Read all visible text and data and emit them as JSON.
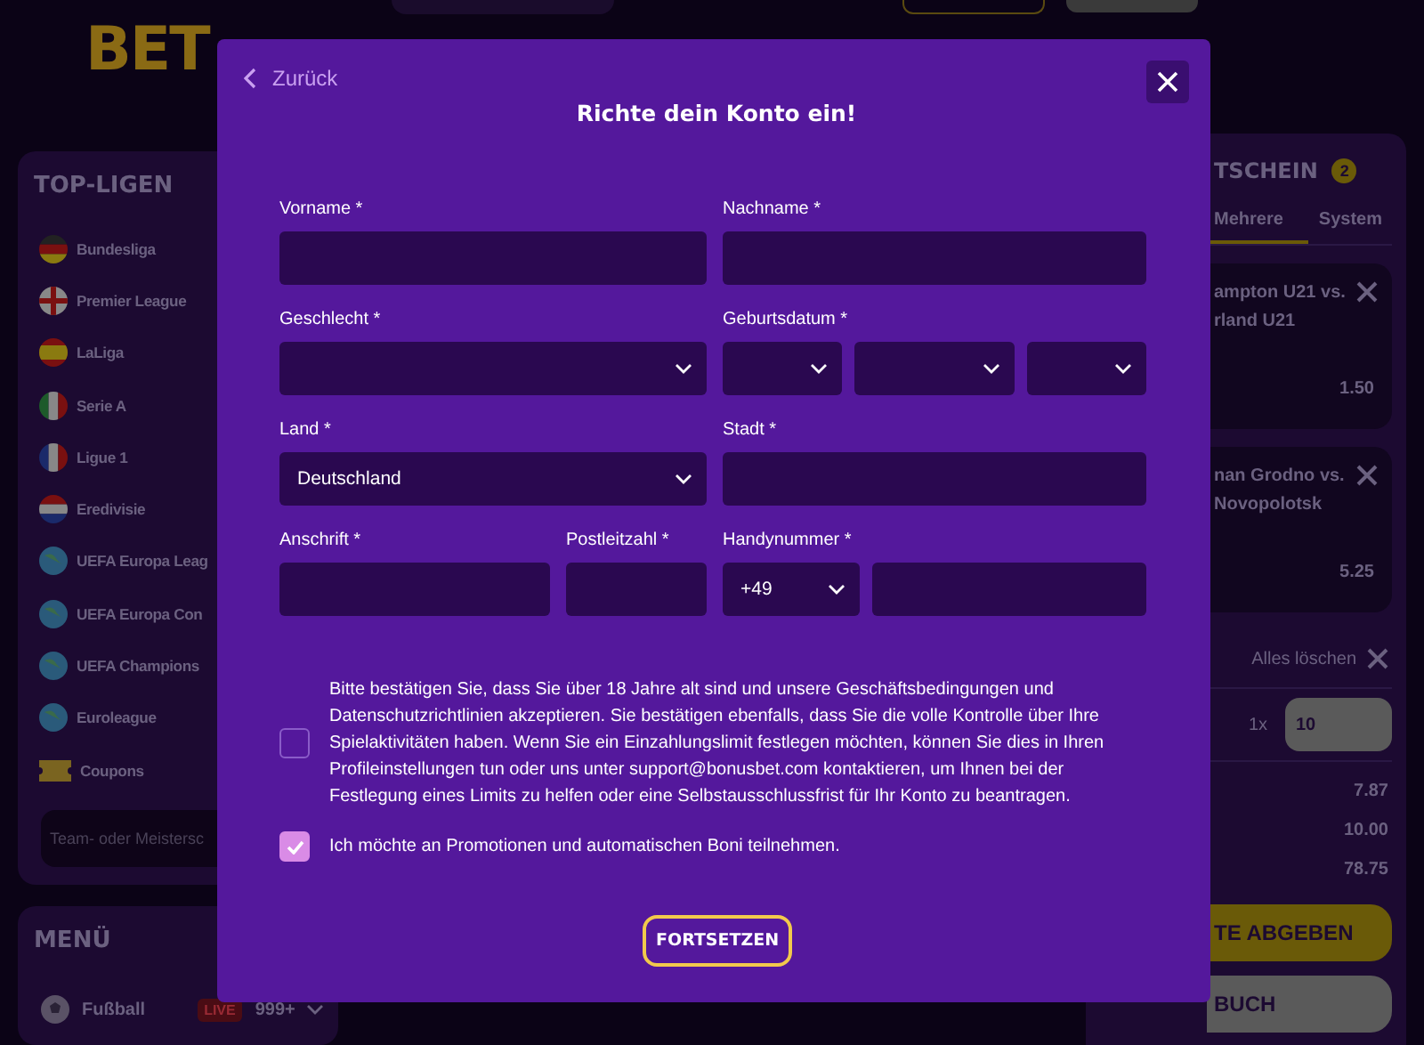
{
  "header": {
    "logo_text": "BET"
  },
  "sidebar": {
    "title": "TOP-LIGEN",
    "leagues": [
      {
        "name": "Bundesliga",
        "kind": "de"
      },
      {
        "name": "Premier League",
        "kind": "en"
      },
      {
        "name": "LaLiga",
        "kind": "es"
      },
      {
        "name": "Serie A",
        "kind": "it"
      },
      {
        "name": "Ligue 1",
        "kind": "fr"
      },
      {
        "name": "Eredivisie",
        "kind": "nl"
      },
      {
        "name": "UEFA Europa Leag",
        "kind": "globe"
      },
      {
        "name": "UEFA Europa Con",
        "kind": "globe"
      },
      {
        "name": "UEFA Champions",
        "kind": "globe"
      },
      {
        "name": "Euroleague",
        "kind": "globe"
      },
      {
        "name": "Coupons",
        "kind": "ticket"
      }
    ],
    "search": {
      "placeholder": "Team- oder Meistersc"
    }
  },
  "menu": {
    "title": "MENÜ",
    "items": [
      {
        "label": "Fußball",
        "badge": "LIVE",
        "count": "999+"
      }
    ]
  },
  "betslip": {
    "title": "TSCHEIN",
    "count": "2",
    "tabs": [
      {
        "label": "Mehrere",
        "selected": true
      },
      {
        "label": "System",
        "selected": false
      }
    ],
    "bets": [
      {
        "lines": [
          "ampton U21 vs.",
          "rland U21"
        ],
        "odds": "1.50"
      },
      {
        "lines": [
          "nan Grodno vs.",
          "Novopolotsk"
        ],
        "odds": "5.25"
      }
    ],
    "clear": "Alles löschen",
    "multiplier": "1x",
    "stake": "10",
    "totals": [
      "7.87",
      "10.00",
      "78.75"
    ],
    "buttons": [
      {
        "label": "TE ABGEBEN",
        "kind": "primary"
      },
      {
        "label": "BUCH",
        "kind": "secondary"
      }
    ]
  },
  "modal": {
    "back": "Zurück",
    "title": "Richte dein Konto ein!",
    "rows": [
      [
        {
          "label": "Vorname *",
          "kind": "text"
        },
        {
          "label": "Nachname *",
          "kind": "text"
        }
      ],
      [
        {
          "label": "Geschlecht *",
          "kind": "select"
        },
        {
          "label": "Geburtsdatum *",
          "kind": "date"
        }
      ],
      [
        {
          "label": "Land *",
          "kind": "select",
          "value": "Deutschland"
        },
        {
          "label": "Stadt *",
          "kind": "text"
        }
      ],
      [
        {
          "label": "Anschrift *",
          "kind": "text"
        },
        {
          "label": "Postleitzahl *",
          "kind": "text"
        },
        {
          "label": "Handynummer *",
          "kind": "phone",
          "value": "+49"
        }
      ]
    ],
    "consents": [
      {
        "text": "Bitte bestätigen Sie, dass Sie über 18 Jahre alt sind und unsere Geschäftsbedingungen und Datenschutzrichtlinien akzeptieren. Sie bestätigen ebenfalls, dass Sie die volle Kontrolle über Ihre Spielaktivitäten haben. Wenn Sie ein Einzahlungslimit festlegen möchten, können Sie dies in Ihren Profileinstellungen tun oder uns unter support@bonusbet.com kontaktieren, um Ihnen bei der Festlegung eines Limits zu helfen oder eine Selbstausschlussfrist für Ihr Konto zu beantragen.",
        "checked": false
      },
      {
        "text": "Ich möchte an Promotionen und automatischen Boni teilnehmen.",
        "checked": true
      }
    ],
    "submit": "FORTSETZEN"
  }
}
